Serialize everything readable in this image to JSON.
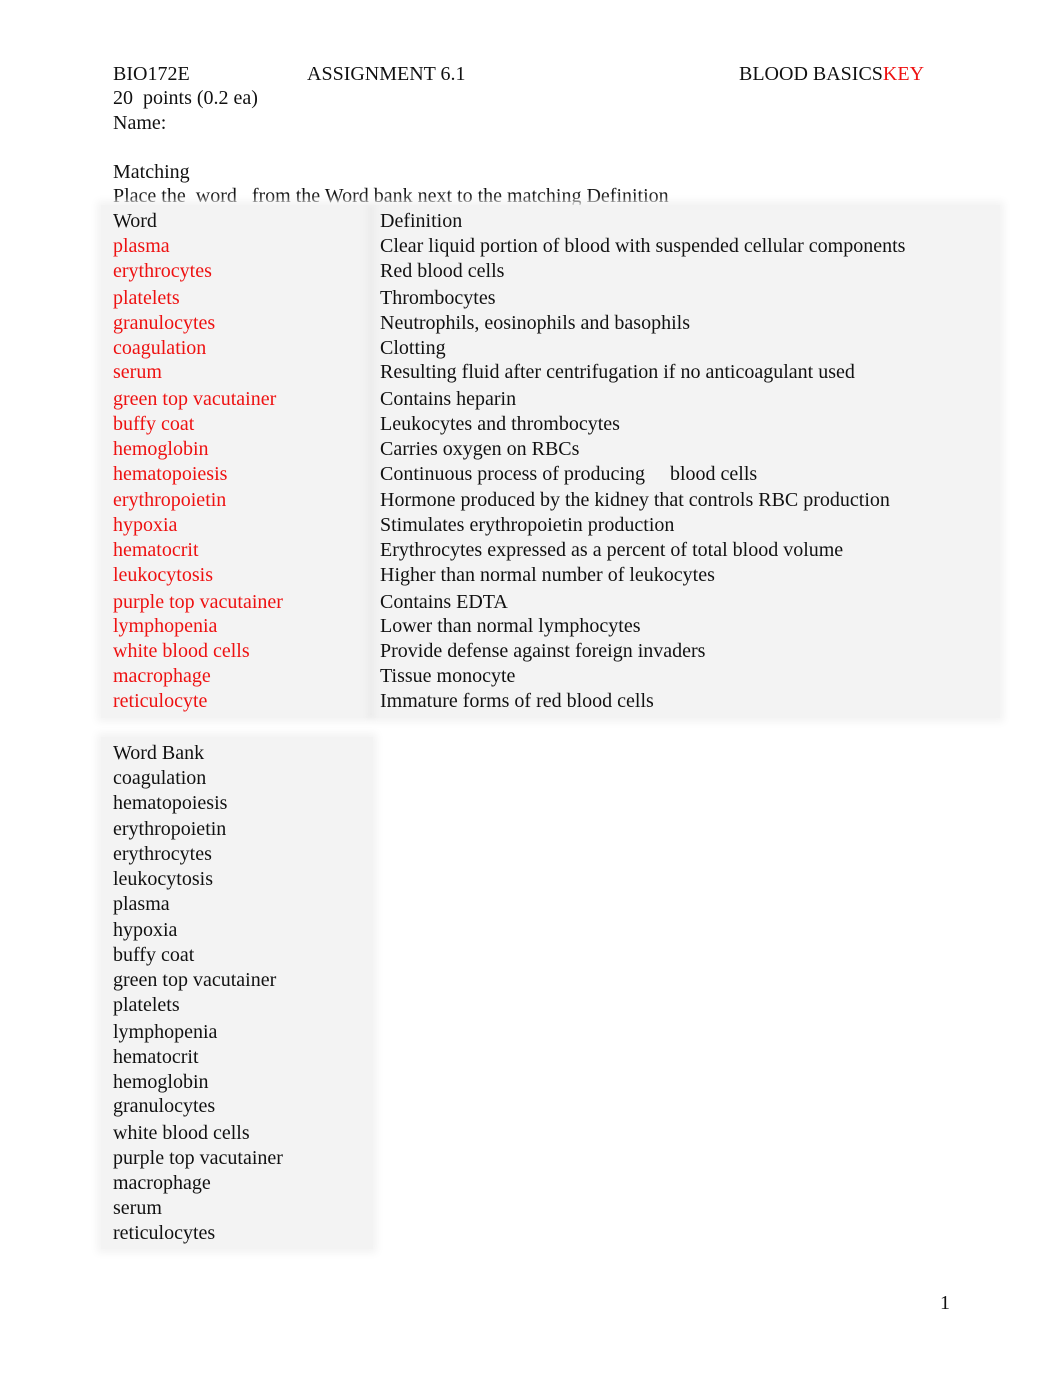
{
  "header": {
    "course": "BIO172E",
    "assignment": "ASSIGNMENT 6.1",
    "title": "BLOOD BASICS",
    "title_suffix": "KEY",
    "points": "20  points (0.2 ea)",
    "name_label": "Name:"
  },
  "instructions": {
    "section": "Matching",
    "text": "Place the  word   from the Word bank next to the matching Definition"
  },
  "colors": {
    "answer": "#ee1111",
    "text": "#111111",
    "table_bg": "#f3f3f3"
  },
  "table": {
    "headers": [
      "Word",
      "Definition"
    ],
    "rows": [
      {
        "word": "plasma",
        "definition": "Clear liquid portion of blood with suspended cellular components"
      },
      {
        "word": "erythrocytes",
        "definition": "Red blood cells"
      },
      {
        "word": "platelets",
        "definition": "Thrombocytes"
      },
      {
        "word": "granulocytes",
        "definition": "Neutrophils, eosinophils and basophils"
      },
      {
        "word": "coagulation",
        "definition": "Clotting"
      },
      {
        "word": "serum",
        "definition": "Resulting fluid after centrifugation if no anticoagulant used"
      },
      {
        "word": "green top vacutainer",
        "definition": "Contains heparin"
      },
      {
        "word": "buffy coat",
        "definition": "Leukocytes and thrombocytes"
      },
      {
        "word": "hemoglobin",
        "definition": "Carries oxygen on RBCs"
      },
      {
        "word": "hematopoiesis",
        "definition": "Continuous process of producing     blood cells"
      },
      {
        "word": "erythropoietin",
        "definition": "Hormone produced by the kidney that controls RBC production"
      },
      {
        "word": "hypoxia",
        "definition": "Stimulates erythropoietin production"
      },
      {
        "word": "hematocrit",
        "definition": "Erythrocytes expressed as a percent of total blood volume"
      },
      {
        "word": "leukocytosis",
        "definition": "Higher than normal number of leukocytes"
      },
      {
        "word": "purple top vacutainer",
        "definition": "Contains EDTA"
      },
      {
        "word": "lymphopenia",
        "definition": "Lower than normal lymphocytes"
      },
      {
        "word": "white blood cells",
        "definition": "Provide defense against foreign invaders"
      },
      {
        "word": "macrophage",
        "definition": "Tissue monocyte"
      },
      {
        "word": "reticulocyte",
        "definition": "Immature forms of red blood cells"
      }
    ]
  },
  "word_bank": {
    "header": "Word Bank",
    "items": [
      "coagulation",
      "hematopoiesis",
      "erythropoietin",
      "erythrocytes",
      "leukocytosis",
      "plasma",
      "hypoxia",
      "buffy coat",
      "green top vacutainer",
      "platelets",
      "lymphopenia",
      "hematocrit",
      "hemoglobin",
      "granulocytes",
      "white blood cells",
      "purple top vacutainer",
      "macrophage",
      "serum",
      "reticulocytes"
    ]
  },
  "footer": {
    "page_number": "1"
  }
}
